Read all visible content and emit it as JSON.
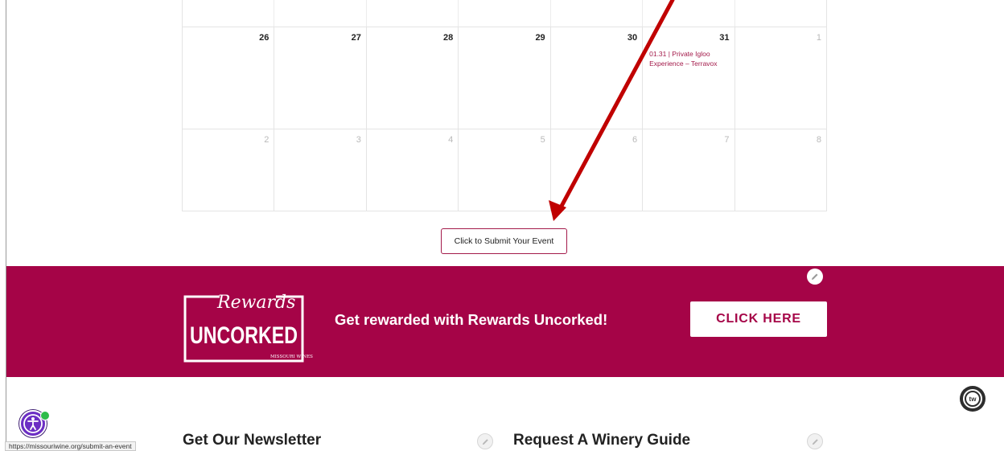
{
  "calendar": {
    "rows": [
      {
        "days": [
          "",
          "",
          "",
          "",
          "",
          "",
          ""
        ]
      },
      {
        "days": [
          {
            "num": "26",
            "muted": false
          },
          {
            "num": "27",
            "muted": false
          },
          {
            "num": "28",
            "muted": false
          },
          {
            "num": "29",
            "muted": false
          },
          {
            "num": "30",
            "muted": false
          },
          {
            "num": "31",
            "muted": false
          },
          {
            "num": "1",
            "muted": true
          }
        ]
      },
      {
        "days": [
          {
            "num": "2",
            "muted": true
          },
          {
            "num": "3",
            "muted": true
          },
          {
            "num": "4",
            "muted": true
          },
          {
            "num": "5",
            "muted": true
          },
          {
            "num": "6",
            "muted": true
          },
          {
            "num": "7",
            "muted": true
          },
          {
            "num": "8",
            "muted": true
          }
        ]
      }
    ],
    "event": {
      "label": "01.31 | Private Igloo Experience – Terravox",
      "color": "#a31a4a"
    }
  },
  "submit_button": {
    "label": "Click to Submit Your Event"
  },
  "annotation": {
    "type": "arrow",
    "color": "#c00000"
  },
  "banner": {
    "logo": {
      "script": "Rewards",
      "wordmark": "UNCORKED",
      "sub": "MISSOURI WINES"
    },
    "text": "Get rewarded with Rewards Uncorked!",
    "cta": "CLICK HERE",
    "background": "#a50447"
  },
  "footer": {
    "newsletter_heading": "Get Our Newsletter",
    "guide_heading": "Request A Winery Guide",
    "badge_label": "tw"
  },
  "status_bar": {
    "url": "https://missouriwine.org/submit-an-event"
  },
  "icons": [
    "pencil-icon",
    "accessibility-icon",
    "checkmark-icon",
    "tw-badge-icon"
  ]
}
